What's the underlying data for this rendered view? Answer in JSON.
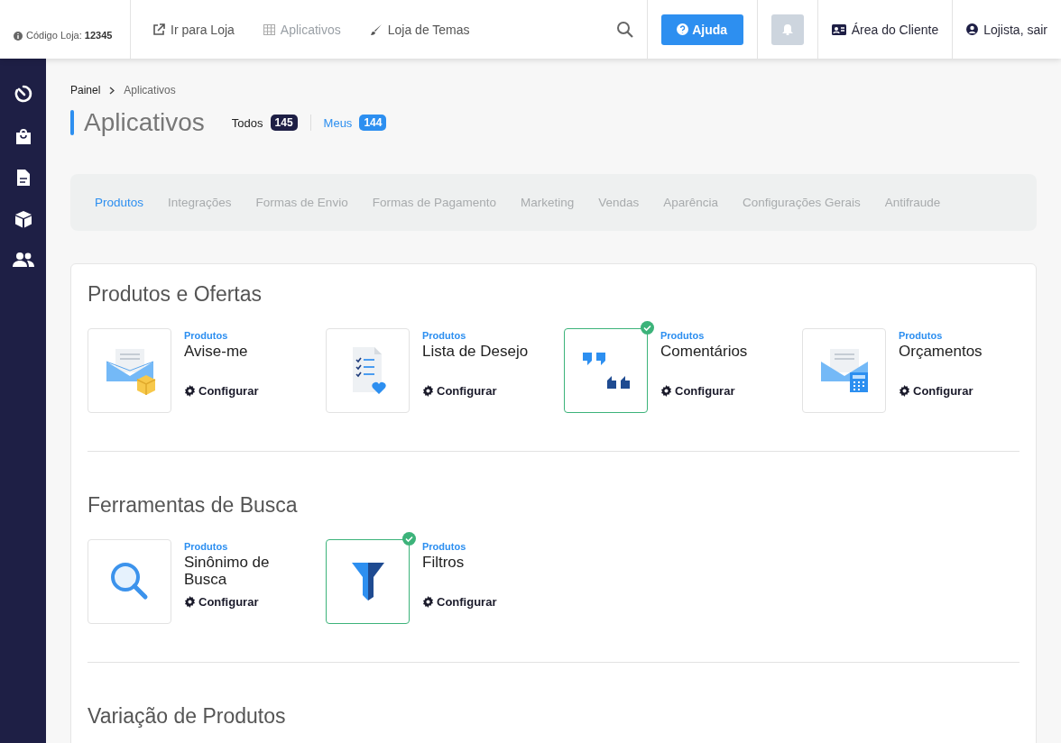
{
  "topbar": {
    "store_code": {
      "label": "Código Loja:",
      "value": "12345"
    },
    "links": [
      {
        "label": "Ir para Loja",
        "kind": "external",
        "selected": false
      },
      {
        "label": "Aplicativos",
        "kind": "grid",
        "selected": true
      },
      {
        "label": "Loja de Temas",
        "kind": "brush",
        "selected": false
      }
    ],
    "help_button": "Ajuda",
    "client_area": "Área do Cliente",
    "user": "Lojista, sair"
  },
  "sidebar": {
    "items": [
      {
        "kind": "stopwatch"
      },
      {
        "kind": "bag"
      },
      {
        "kind": "document"
      },
      {
        "kind": "cube"
      },
      {
        "kind": "users"
      }
    ]
  },
  "breadcrumb": [
    "Painel",
    "Aplicativos"
  ],
  "page_title": "Aplicativos",
  "filters": [
    {
      "label": "Todos",
      "count": "145",
      "selected": true
    },
    {
      "label": "Meus",
      "count": "144",
      "selected": false
    }
  ],
  "tabs": [
    {
      "label": "Produtos",
      "selected": true
    },
    {
      "label": "Integrações",
      "selected": false
    },
    {
      "label": "Formas de Envio",
      "selected": false
    },
    {
      "label": "Formas de Pagamento",
      "selected": false
    },
    {
      "label": "Marketing",
      "selected": false
    },
    {
      "label": "Vendas",
      "selected": false
    },
    {
      "label": "Aparência",
      "selected": false
    },
    {
      "label": "Configurações Gerais",
      "selected": false
    },
    {
      "label": "Antifraude",
      "selected": false
    }
  ],
  "sections": [
    {
      "title": "Produtos e Ofertas",
      "apps": [
        {
          "category": "Produtos",
          "name": "Avise-me",
          "kind": "mail-box",
          "installed": false,
          "action": "Configurar"
        },
        {
          "category": "Produtos",
          "name": "Lista de Desejo",
          "kind": "wishlist",
          "installed": false,
          "action": "Configurar"
        },
        {
          "category": "Produtos",
          "name": "Comentários",
          "kind": "quotes",
          "installed": true,
          "action": "Configurar"
        },
        {
          "category": "Produtos",
          "name": "Orçamentos",
          "kind": "mail-calc",
          "installed": false,
          "action": "Configurar"
        }
      ]
    },
    {
      "title": "Ferramentas de Busca",
      "apps": [
        {
          "category": "Produtos",
          "name": "Sinônimo de Busca",
          "kind": "search",
          "installed": false,
          "action": "Configurar"
        },
        {
          "category": "Produtos",
          "name": "Filtros",
          "kind": "funnel",
          "installed": true,
          "action": "Configurar"
        }
      ]
    },
    {
      "title": "Variação de Produtos"
    }
  ]
}
